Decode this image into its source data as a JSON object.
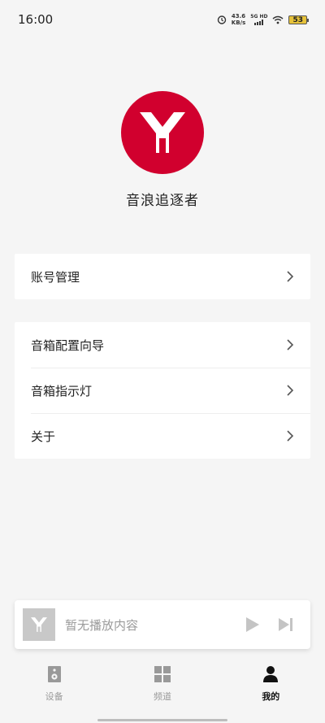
{
  "status": {
    "time": "16:00",
    "speed_value": "43.6",
    "speed_unit": "KB/s",
    "network": "5G HD",
    "battery": "53"
  },
  "profile": {
    "name": "音浪追逐者"
  },
  "menu": {
    "account": "账号管理",
    "setup_wizard": "音箱配置向导",
    "indicator_light": "音箱指示灯",
    "about": "关于"
  },
  "player": {
    "empty_text": "暂无播放内容"
  },
  "tabs": [
    {
      "label": "设备",
      "icon": "speaker-icon"
    },
    {
      "label": "频道",
      "icon": "grid-icon"
    },
    {
      "label": "我的",
      "icon": "person-icon"
    }
  ],
  "colors": {
    "brand": "#d1002e",
    "background": "#f5f5f5",
    "inactive": "#999999",
    "active": "#111111"
  }
}
